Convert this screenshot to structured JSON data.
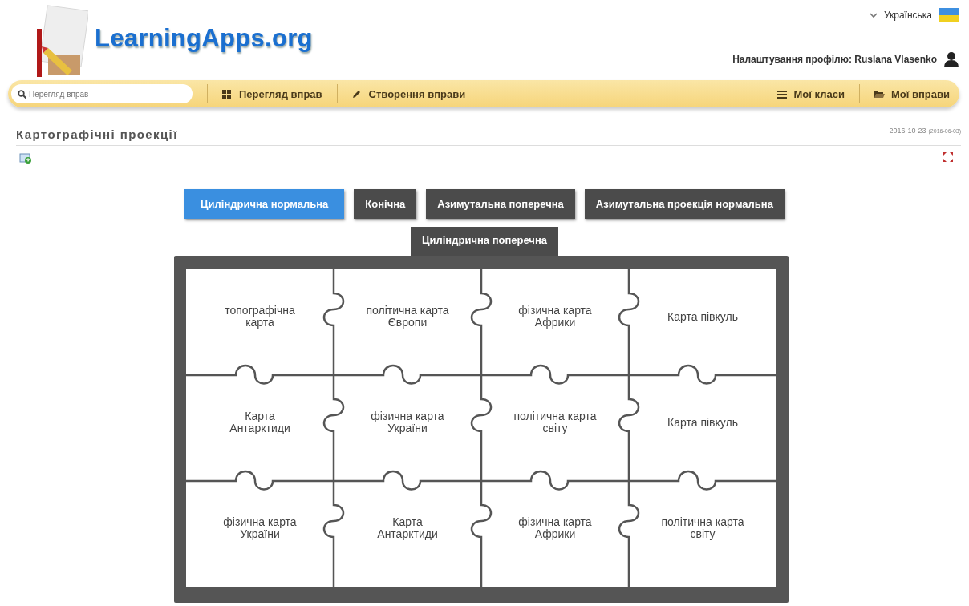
{
  "header": {
    "logo": "LearningApps.org",
    "language": "Українська",
    "profile": "Налаштування профілю: Ruslana Vlasenko"
  },
  "nav": {
    "search": {
      "placeholder": "Перегляд вправ"
    },
    "left_items": [
      {
        "label": "Перегляд вправ",
        "kind": "grid"
      },
      {
        "label": "Створення вправи",
        "kind": "pencil"
      }
    ],
    "right_items": [
      {
        "label": "Мої класи",
        "kind": "list"
      },
      {
        "label": "Мої вправи",
        "kind": "folder"
      }
    ]
  },
  "title": "Картографічні проекції",
  "date": "2016-10-23",
  "date_created": "(2016-06-03)",
  "tabs": [
    {
      "label": "Циліндрична нормальна",
      "selected": true
    },
    {
      "label": "Конічна",
      "selected": false
    },
    {
      "label": "Азимутальна поперечна",
      "selected": false
    },
    {
      "label": "Азимутальна проекція нормальна",
      "selected": false
    },
    {
      "label": "Циліндрична поперечна",
      "selected": false
    }
  ],
  "pieces": [
    "топографічна карта",
    "політична карта Європи",
    "фізична карта Африки",
    "Карта півкуль",
    "Карта Антарктиди",
    "фізична карта України",
    "політична карта світу",
    "Карта півкуль",
    "фізична карта України",
    "Карта Антарктиди",
    "фізична карта Африки",
    "політична карта світу"
  ]
}
